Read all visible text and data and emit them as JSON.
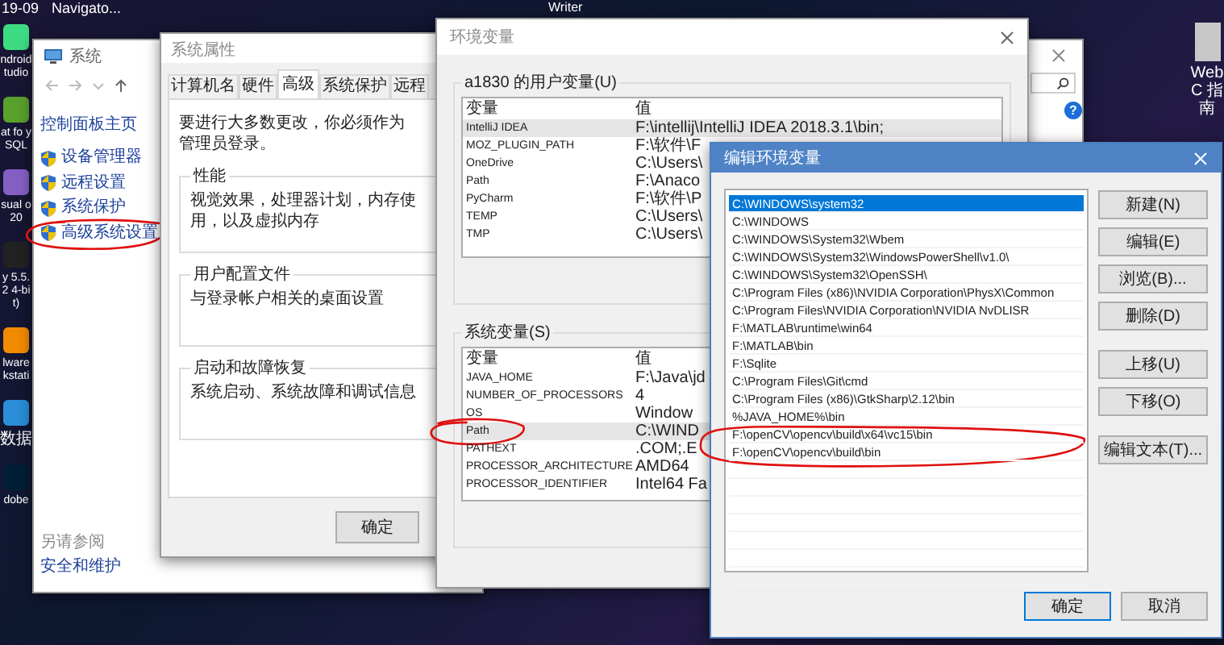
{
  "desktop": {
    "top_labels": [
      "19-09",
      "Navigato...",
      "Writer"
    ],
    "icons": [
      {
        "label": "ndroid tudio",
        "color": "#3ddc84"
      },
      {
        "label": "at fo ySQL",
        "color": "#5aa02c"
      },
      {
        "label": "sual o 20",
        "color": "#865fc5"
      },
      {
        "label": "y 5.5.2 4-bit)",
        "color": "#222222"
      },
      {
        "label": "lware kstati",
        "color": "#f38b00"
      },
      {
        "label": "数据",
        "color": "#2a8fd8"
      },
      {
        "label": "dobe",
        "color": "#001e36"
      }
    ],
    "right_icon": {
      "label": "WebC 指南"
    }
  },
  "system_window": {
    "title": "系统",
    "home_link": "控制面板主页",
    "links": [
      {
        "label": "设备管理器",
        "circled": false
      },
      {
        "label": "远程设置",
        "circled": false
      },
      {
        "label": "系统保护",
        "circled": false
      },
      {
        "label": "高级系统设置",
        "circled": true
      }
    ],
    "see_also": "另请参阅",
    "see_also_links": [
      "安全和维护"
    ]
  },
  "system_properties": {
    "title": "系统属性",
    "tabs": [
      {
        "label": "计算机名",
        "selected": false
      },
      {
        "label": "硬件",
        "selected": false
      },
      {
        "label": "高级",
        "selected": true
      },
      {
        "label": "系统保护",
        "selected": false
      },
      {
        "label": "远程",
        "selected": false
      }
    ],
    "notice": "要进行大多数更改，你必须作为管理员登录。",
    "groups": [
      {
        "title": "性能",
        "text": "视觉效果，处理器计划，内存使用，以及虚拟内存"
      },
      {
        "title": "用户配置文件",
        "text": "与登录帐户相关的桌面设置"
      },
      {
        "title": "启动和故障恢复",
        "text": "系统启动、系统故障和调试信息"
      }
    ],
    "buttons": [
      "确定"
    ]
  },
  "behind_window": {
    "help": "?"
  },
  "env_window": {
    "title": "环境变量",
    "sections": [
      {
        "title": "a1830 的用户变量(U)",
        "columns": [
          "变量",
          "值"
        ],
        "rows": [
          {
            "name": "IntelliJ IDEA",
            "value": "F:\\intellij\\IntelliJ IDEA 2018.3.1\\bin;",
            "selected": true,
            "circled": false
          },
          {
            "name": "MOZ_PLUGIN_PATH",
            "value": "F:\\软件\\F",
            "selected": false,
            "circled": false
          },
          {
            "name": "OneDrive",
            "value": "C:\\Users\\",
            "selected": false,
            "circled": false
          },
          {
            "name": "Path",
            "value": "F:\\Anaco",
            "selected": false,
            "circled": false
          },
          {
            "name": "PyCharm",
            "value": "F:\\软件\\P",
            "selected": false,
            "circled": false
          },
          {
            "name": "TEMP",
            "value": "C:\\Users\\",
            "selected": false,
            "circled": false
          },
          {
            "name": "TMP",
            "value": "C:\\Users\\",
            "selected": false,
            "circled": false
          }
        ]
      },
      {
        "title": "系统变量(S)",
        "columns": [
          "变量",
          "值"
        ],
        "rows": [
          {
            "name": "JAVA_HOME",
            "value": "F:\\Java\\jd",
            "selected": false,
            "circled": false
          },
          {
            "name": "NUMBER_OF_PROCESSORS",
            "value": "4",
            "selected": false,
            "circled": false
          },
          {
            "name": "OS",
            "value": "Window",
            "selected": false,
            "circled": false
          },
          {
            "name": "Path",
            "value": "C:\\WIND",
            "selected": true,
            "circled": true
          },
          {
            "name": "PATHEXT",
            "value": ".COM;.E",
            "selected": false,
            "circled": false
          },
          {
            "name": "PROCESSOR_ARCHITECTURE",
            "value": "AMD64",
            "selected": false,
            "circled": false
          },
          {
            "name": "PROCESSOR_IDENTIFIER",
            "value": "Intel64 Fa",
            "selected": false,
            "circled": false
          }
        ]
      }
    ]
  },
  "edit_dialog": {
    "title": "编辑环境变量",
    "entries": [
      {
        "text": "C:\\WINDOWS\\system32",
        "selected": true,
        "circled": false
      },
      {
        "text": "C:\\WINDOWS",
        "selected": false,
        "circled": false
      },
      {
        "text": "C:\\WINDOWS\\System32\\Wbem",
        "selected": false,
        "circled": false
      },
      {
        "text": "C:\\WINDOWS\\System32\\WindowsPowerShell\\v1.0\\",
        "selected": false,
        "circled": false
      },
      {
        "text": "C:\\WINDOWS\\System32\\OpenSSH\\",
        "selected": false,
        "circled": false
      },
      {
        "text": "C:\\Program Files (x86)\\NVIDIA Corporation\\PhysX\\Common",
        "selected": false,
        "circled": false
      },
      {
        "text": "C:\\Program Files\\NVIDIA Corporation\\NVIDIA NvDLISR",
        "selected": false,
        "circled": false
      },
      {
        "text": "F:\\MATLAB\\runtime\\win64",
        "selected": false,
        "circled": false
      },
      {
        "text": "F:\\MATLAB\\bin",
        "selected": false,
        "circled": false
      },
      {
        "text": "F:\\Sqlite",
        "selected": false,
        "circled": false
      },
      {
        "text": "C:\\Program Files\\Git\\cmd",
        "selected": false,
        "circled": false
      },
      {
        "text": "C:\\Program Files (x86)\\GtkSharp\\2.12\\bin",
        "selected": false,
        "circled": false
      },
      {
        "text": "%JAVA_HOME%\\bin",
        "selected": false,
        "circled": false
      },
      {
        "text": "F:\\openCV\\opencv\\build\\x64\\vc15\\bin",
        "selected": false,
        "circled": true
      },
      {
        "text": "F:\\openCV\\opencv\\build\\bin",
        "selected": false,
        "circled": true
      }
    ],
    "side_button_groups": [
      [
        "新建(N)",
        "编辑(E)",
        "浏览(B)...",
        "删除(D)"
      ],
      [
        "上移(U)",
        "下移(O)"
      ],
      [
        "编辑文本(T)..."
      ]
    ],
    "footer_buttons": [
      {
        "label": "确定",
        "default": true
      },
      {
        "label": "取消",
        "default": false
      }
    ]
  }
}
